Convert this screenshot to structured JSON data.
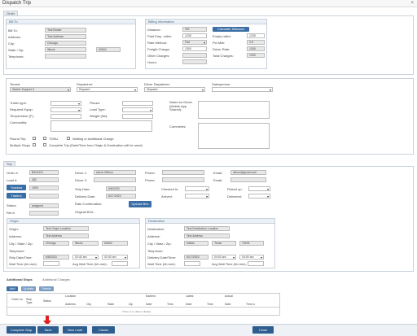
{
  "window": {
    "title": "Dispatch Trip",
    "close": "×"
  },
  "order_tab": "Order",
  "bill_to": {
    "header": "Bill To",
    "bill_to_label": "Bill To:",
    "bill_to_value": "Test Broker",
    "address_label": "Address:",
    "address_value": "Test Address",
    "city_label": "City:",
    "city_value": "Chicago",
    "state_zip_label": "State / Zip:",
    "state_value": "Illinois",
    "zip_value": "60604",
    "telephone_label": "Telephone:"
  },
  "billing": {
    "header": "Billing Information",
    "distance_label": "Distance:",
    "distance_value": "301",
    "calc_button": "Calculate Distance",
    "paid_empty_label": "Paid Emp. miles:",
    "paid_empty_value": "1235",
    "empty_miles_label": "Empty miles:",
    "empty_miles_value": "1235",
    "rate_method_label": "Rate Method:",
    "rate_method_value": "Flat",
    "pct_label": "Pct Mile:",
    "pct_value": "0.8",
    "freight_label": "Freight Charge:",
    "freight_value": "1300",
    "driver_rate_label": "Driver Rate:",
    "driver_rate_value": "1300",
    "other_label": "Other Charges:",
    "total_label": "Total Charges:",
    "total_value": "1300",
    "hours_label": "Hours:"
  },
  "dispatch": {
    "tenant_label": "Tenant:",
    "tenant_value": "Starter Support 3",
    "dispatcher_label": "Dispatcher:",
    "dispatcher_value": "Dispatch",
    "driver_dispatcher_label": "Driver Dispatcher:",
    "driver_dispatcher_value": "Dispatch",
    "salesperson_label": "Salesperson:"
  },
  "details": {
    "trailer_type_label": "Trailer type:",
    "required_equip_label": "Required Equip:",
    "temperature_label": "Temperature (F):",
    "commodity_label": "Commodity:",
    "pieces_label": "Pieces:",
    "load_type_label": "Load Type:",
    "weight_label": "Weight (lbs):",
    "notes_label": "Notes for Driver (Mobile App Shared):",
    "comments_label": "Comments:",
    "round_trip_label": "Round Trip",
    "tonu_label": "TONU",
    "waiting_label": "Waiting or Additional Charge",
    "multiple_stops_label": "Multiple Stops",
    "complete_trip_label": "Complete Trip (Date/Time from Origin & Destination will be used)"
  },
  "trip_tab": "Trip",
  "trip": {
    "order_label": "Order #:",
    "order_value": "B529431",
    "load_label": "Load #:",
    "load_value": "282",
    "tractors_button": "Tractors",
    "tractors_value": "1909",
    "trailers_button": "Trailers",
    "status_label": "Status:",
    "status_value": "assigned",
    "ref_label": "Ref #:",
    "driver1_label": "Driver 1:",
    "driver1_value": "Aaron Wilson",
    "driver2_label": "Driver 2:",
    "phone1_label": "Phone:",
    "phone2_label": "Phone:",
    "email1_label": "Email:",
    "email1_value": "wilson@gmail.com",
    "email2_label": "Email:",
    "ship_date_label": "Ship Date:",
    "ship_date_value": "6/8/2023",
    "delivery_date_label": "Delivery Date:",
    "delivery_date_value": "6/17/2023",
    "rate_conf_label": "Rate Confirmation:",
    "upload_button": "Upload files",
    "original_bol_label": "Original BOL:",
    "checked_in_label": "Checked In:",
    "arrived_label": "Arrived:",
    "picked_up_label": "Picked up:",
    "delivered_label": "Delivered:"
  },
  "origin": {
    "header": "Origin",
    "origin_label": "Origin:",
    "origin_value": "Test Origin Location",
    "address_label": "Address:",
    "address_value": "Test Address",
    "csz_label": "City / State / Zip:",
    "city_value": "Chicago",
    "state_value": "Illinois",
    "zip_value": "60604",
    "telephone_label": "Telephone:",
    "ship_dt_label": "Ship Date/Time:",
    "ship_date_value": "6/8/2023",
    "time1_value": "02:40 am",
    "time2_value": "02:40 am",
    "wait_label": "Wait Time (hh:mm):",
    "avg_wait_label": "Avg Wait Time (hh:mm):"
  },
  "destination": {
    "header": "Destination",
    "dest_label": "Destination:",
    "dest_value": "Test Destination Location",
    "address_label": "Address:",
    "address_value": "Test Address",
    "csz_label": "City / State / Zip:",
    "city_value": "Dallas",
    "state_value": "Texas",
    "zip_value": "75201",
    "telephone_label": "Telephone:",
    "delivery_dt_label": "Delivery Date/Time:",
    "delivery_date_value": "6/17/2023",
    "time1_value": "04:00 am",
    "time2_value": "04:00 am",
    "wait_label": "Wait Time (hh:mm):",
    "avg_wait_label": "Avg Wait Time (hh:mm):"
  },
  "stops_tabs": {
    "additional_stops": "Additional Stops",
    "additional_charges": "Additional Charges"
  },
  "stops_buttons": {
    "add": "Add",
    "update": "Update",
    "delete": "Delete"
  },
  "stops_table": {
    "group_location": "Location",
    "group_earliest": "Earliest",
    "group_latest": "Latest",
    "group_actual": "Actual",
    "col_order": "Order no",
    "col_stop_type": "Stop Type",
    "col_status": "Status",
    "col_address": "Address",
    "col_city": "City",
    "col_state": "State",
    "col_zip": "Zip",
    "col_e_date": "Date",
    "col_e_time": "Time",
    "col_l_date": "Date",
    "col_l_time": "Time",
    "col_a_date": "Date",
    "col_a_time": "Time a",
    "empty": "There is no data to display"
  },
  "footer": {
    "complete_stop": "Complete Stop",
    "save": "Save",
    "view_route": "View route",
    "claims": "Claims",
    "close": "Close"
  },
  "colors": {
    "accent": "#3a6ea5",
    "header_text": "#4a6784",
    "arrow": "#e02020"
  }
}
